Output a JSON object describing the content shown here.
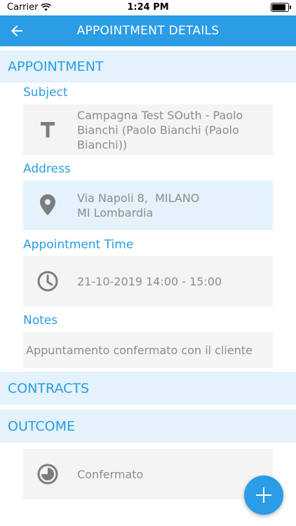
{
  "status_bar": {
    "carrier": "Carrier",
    "time": "1:24 PM",
    "battery_level": 0.85
  },
  "app_bar": {
    "title": "APPOINTMENT DETAILS",
    "back_icon": "arrow-left-icon"
  },
  "sections": {
    "appointment": "APPOINTMENT",
    "contracts": "CONTRACTS",
    "outcome": "OUTCOME"
  },
  "subject": {
    "label": "Subject",
    "value": "Campagna Test SOuth - Paolo Bianchi (Paolo Bianchi (Paolo Bianchi))",
    "icon": "text-t-icon"
  },
  "address": {
    "label": "Address",
    "line1": "Via Napoli 8,  MILANO",
    "line2": "MI Lombardia",
    "icon": "location-pin-icon"
  },
  "appointment_time": {
    "label": "Appointment Time",
    "value": "21-10-2019 14:00 - 15:00",
    "icon": "clock-icon"
  },
  "notes": {
    "label": "Notes",
    "value": "Appuntamento confermato con il cliente"
  },
  "outcome": {
    "value": "Confermato",
    "icon": "status-pie-icon"
  },
  "fab": {
    "icon": "plus-icon"
  },
  "colors": {
    "primary": "#2a9de6",
    "section_bg": "#e3f2fb",
    "field_bg": "#f4f4f4",
    "text_gray": "#8c8c8c"
  }
}
